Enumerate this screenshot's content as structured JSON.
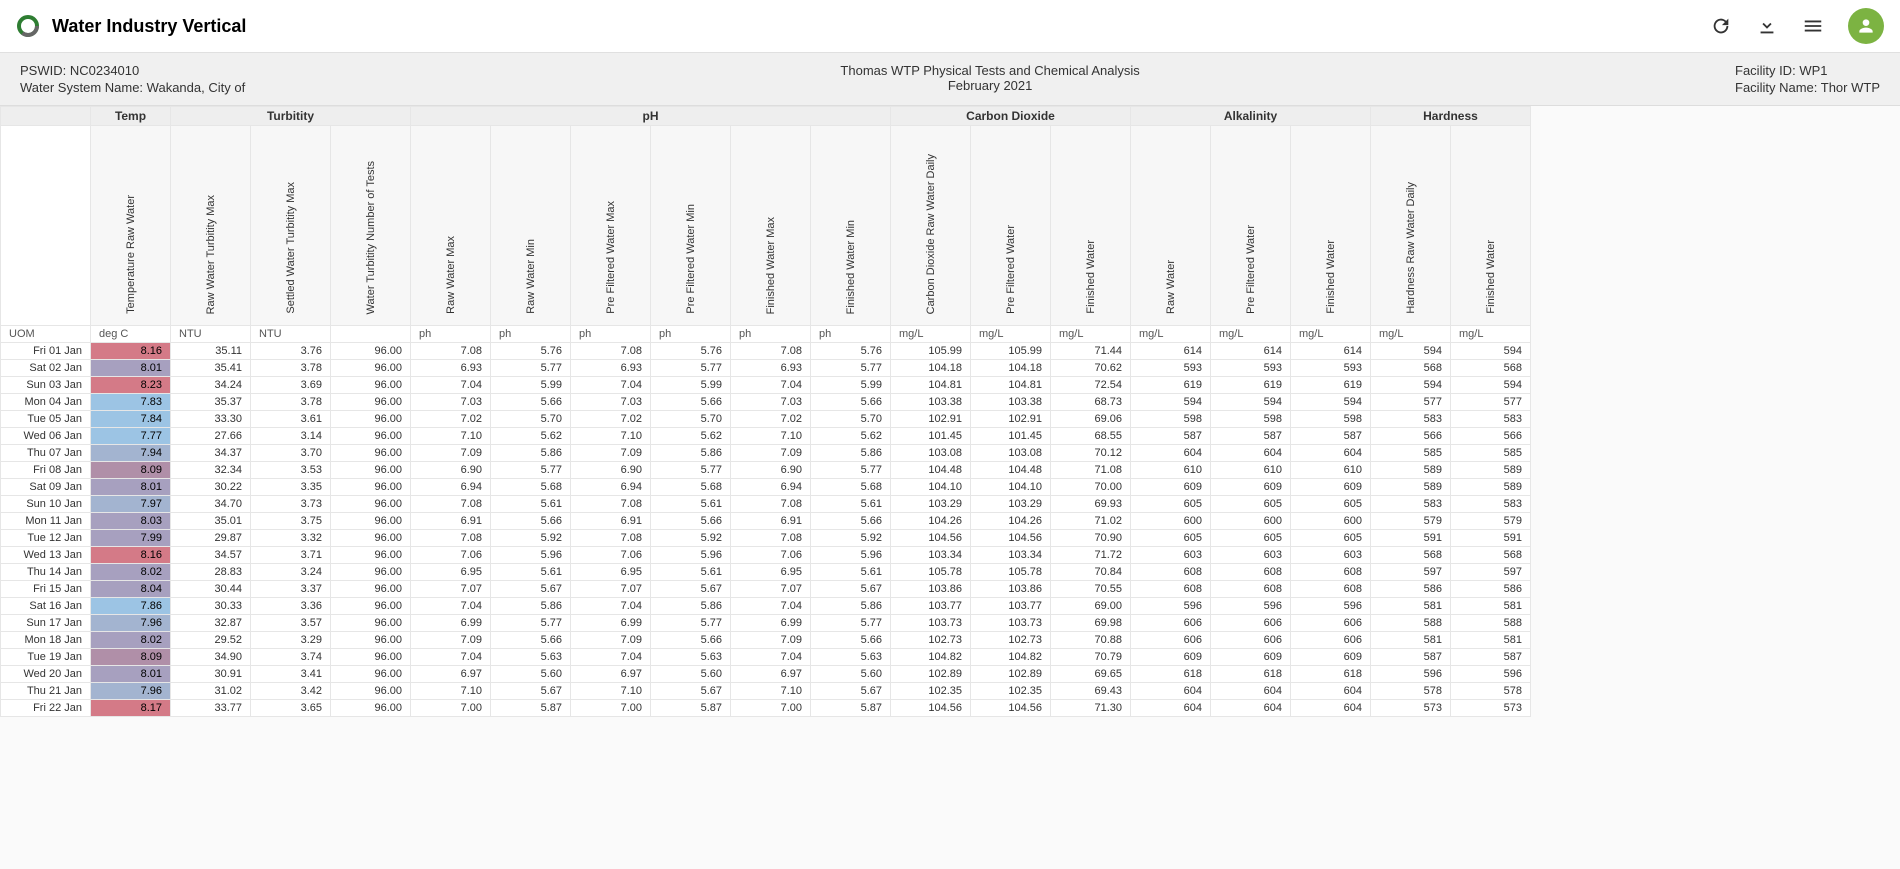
{
  "app": {
    "title": "Water Industry Vertical"
  },
  "info": {
    "left": {
      "pswid_label": "PSWID:",
      "pswid_value": "NC0234010",
      "wsn_label": "Water System Name:",
      "wsn_value": "Wakanda, City of"
    },
    "center": {
      "title": "Thomas WTP Physical Tests and Chemical Analysis",
      "subtitle": "February 2021"
    },
    "right": {
      "facid_label": "Facility ID:",
      "facid_value": "WP1",
      "facname_label": "Facility Name:",
      "facname_value": "Thor WTP"
    }
  },
  "groups": [
    {
      "label": "",
      "span": 1
    },
    {
      "label": "Temp",
      "span": 1
    },
    {
      "label": "Turbitity",
      "span": 3
    },
    {
      "label": "pH",
      "span": 6
    },
    {
      "label": "Carbon Dioxide",
      "span": 3
    },
    {
      "label": "Alkalinity",
      "span": 3
    },
    {
      "label": "Hardness",
      "span": 2
    }
  ],
  "subheaders": [
    "",
    "Temperature Raw Water",
    "Raw Water Turbitity Max",
    "Settled Water Turbitity Max",
    "Water Turbitity Number of Tests",
    "Raw Water Max",
    "Raw Water Min",
    "Pre Filtered Water Max",
    "Pre Filtered Water Min",
    "Finished Water Max",
    "Finished Water Min",
    "Carbon Dioxide Raw Water Daily",
    "Pre Filtered Water",
    "Finished Water",
    "Raw Water",
    "Pre Filtered Water",
    "Finished Water",
    "Hardness Raw Water Daily",
    "Finished Water"
  ],
  "uom_label": "UOM",
  "uom": [
    "deg C",
    "NTU",
    "NTU",
    "",
    "ph",
    "ph",
    "ph",
    "ph",
    "ph",
    "ph",
    "mg/L",
    "mg/L",
    "mg/L",
    "mg/L",
    "mg/L",
    "mg/L",
    "mg/L",
    "mg/L"
  ],
  "rows": [
    {
      "date": "Fri 01 Jan",
      "v": [
        8.16,
        35.11,
        3.76,
        96.0,
        7.08,
        5.76,
        7.08,
        5.76,
        7.08,
        5.76,
        105.99,
        105.99,
        71.44,
        614,
        614,
        614,
        594,
        594
      ]
    },
    {
      "date": "Sat 02 Jan",
      "v": [
        8.01,
        35.41,
        3.78,
        96.0,
        6.93,
        5.77,
        6.93,
        5.77,
        6.93,
        5.77,
        104.18,
        104.18,
        70.62,
        593,
        593,
        593,
        568,
        568
      ]
    },
    {
      "date": "Sun 03 Jan",
      "v": [
        8.23,
        34.24,
        3.69,
        96.0,
        7.04,
        5.99,
        7.04,
        5.99,
        7.04,
        5.99,
        104.81,
        104.81,
        72.54,
        619,
        619,
        619,
        594,
        594
      ]
    },
    {
      "date": "Mon 04 Jan",
      "v": [
        7.83,
        35.37,
        3.78,
        96.0,
        7.03,
        5.66,
        7.03,
        5.66,
        7.03,
        5.66,
        103.38,
        103.38,
        68.73,
        594,
        594,
        594,
        577,
        577
      ]
    },
    {
      "date": "Tue 05 Jan",
      "v": [
        7.84,
        33.3,
        3.61,
        96.0,
        7.02,
        5.7,
        7.02,
        5.7,
        7.02,
        5.7,
        102.91,
        102.91,
        69.06,
        598,
        598,
        598,
        583,
        583
      ]
    },
    {
      "date": "Wed 06 Jan",
      "v": [
        7.77,
        27.66,
        3.14,
        96.0,
        7.1,
        5.62,
        7.1,
        5.62,
        7.1,
        5.62,
        101.45,
        101.45,
        68.55,
        587,
        587,
        587,
        566,
        566
      ]
    },
    {
      "date": "Thu 07 Jan",
      "v": [
        7.94,
        34.37,
        3.7,
        96.0,
        7.09,
        5.86,
        7.09,
        5.86,
        7.09,
        5.86,
        103.08,
        103.08,
        70.12,
        604,
        604,
        604,
        585,
        585
      ]
    },
    {
      "date": "Fri 08 Jan",
      "v": [
        8.09,
        32.34,
        3.53,
        96.0,
        6.9,
        5.77,
        6.9,
        5.77,
        6.9,
        5.77,
        104.48,
        104.48,
        71.08,
        610,
        610,
        610,
        589,
        589
      ]
    },
    {
      "date": "Sat 09 Jan",
      "v": [
        8.01,
        30.22,
        3.35,
        96.0,
        6.94,
        5.68,
        6.94,
        5.68,
        6.94,
        5.68,
        104.1,
        104.1,
        70.0,
        609,
        609,
        609,
        589,
        589
      ]
    },
    {
      "date": "Sun 10 Jan",
      "v": [
        7.97,
        34.7,
        3.73,
        96.0,
        7.08,
        5.61,
        7.08,
        5.61,
        7.08,
        5.61,
        103.29,
        103.29,
        69.93,
        605,
        605,
        605,
        583,
        583
      ]
    },
    {
      "date": "Mon 11 Jan",
      "v": [
        8.03,
        35.01,
        3.75,
        96.0,
        6.91,
        5.66,
        6.91,
        5.66,
        6.91,
        5.66,
        104.26,
        104.26,
        71.02,
        600,
        600,
        600,
        579,
        579
      ]
    },
    {
      "date": "Tue 12 Jan",
      "v": [
        7.99,
        29.87,
        3.32,
        96.0,
        7.08,
        5.92,
        7.08,
        5.92,
        7.08,
        5.92,
        104.56,
        104.56,
        70.9,
        605,
        605,
        605,
        591,
        591
      ]
    },
    {
      "date": "Wed 13 Jan",
      "v": [
        8.16,
        34.57,
        3.71,
        96.0,
        7.06,
        5.96,
        7.06,
        5.96,
        7.06,
        5.96,
        103.34,
        103.34,
        71.72,
        603,
        603,
        603,
        568,
        568
      ]
    },
    {
      "date": "Thu 14 Jan",
      "v": [
        8.02,
        28.83,
        3.24,
        96.0,
        6.95,
        5.61,
        6.95,
        5.61,
        6.95,
        5.61,
        105.78,
        105.78,
        70.84,
        608,
        608,
        608,
        597,
        597
      ]
    },
    {
      "date": "Fri 15 Jan",
      "v": [
        8.04,
        30.44,
        3.37,
        96.0,
        7.07,
        5.67,
        7.07,
        5.67,
        7.07,
        5.67,
        103.86,
        103.86,
        70.55,
        608,
        608,
        608,
        586,
        586
      ]
    },
    {
      "date": "Sat 16 Jan",
      "v": [
        7.86,
        30.33,
        3.36,
        96.0,
        7.04,
        5.86,
        7.04,
        5.86,
        7.04,
        5.86,
        103.77,
        103.77,
        69.0,
        596,
        596,
        596,
        581,
        581
      ]
    },
    {
      "date": "Sun 17 Jan",
      "v": [
        7.96,
        32.87,
        3.57,
        96.0,
        6.99,
        5.77,
        6.99,
        5.77,
        6.99,
        5.77,
        103.73,
        103.73,
        69.98,
        606,
        606,
        606,
        588,
        588
      ]
    },
    {
      "date": "Mon 18 Jan",
      "v": [
        8.02,
        29.52,
        3.29,
        96.0,
        7.09,
        5.66,
        7.09,
        5.66,
        7.09,
        5.66,
        102.73,
        102.73,
        70.88,
        606,
        606,
        606,
        581,
        581
      ]
    },
    {
      "date": "Tue 19 Jan",
      "v": [
        8.09,
        34.9,
        3.74,
        96.0,
        7.04,
        5.63,
        7.04,
        5.63,
        7.04,
        5.63,
        104.82,
        104.82,
        70.79,
        609,
        609,
        609,
        587,
        587
      ]
    },
    {
      "date": "Wed 20 Jan",
      "v": [
        8.01,
        30.91,
        3.41,
        96.0,
        6.97,
        5.6,
        6.97,
        5.6,
        6.97,
        5.6,
        102.89,
        102.89,
        69.65,
        618,
        618,
        618,
        596,
        596
      ]
    },
    {
      "date": "Thu 21 Jan",
      "v": [
        7.96,
        31.02,
        3.42,
        96.0,
        7.1,
        5.67,
        7.1,
        5.67,
        7.1,
        5.67,
        102.35,
        102.35,
        69.43,
        604,
        604,
        604,
        578,
        578
      ]
    },
    {
      "date": "Fri 22 Jan",
      "v": [
        8.17,
        33.77,
        3.65,
        96.0,
        7.0,
        5.87,
        7.0,
        5.87,
        7.0,
        5.87,
        104.56,
        104.56,
        71.3,
        604,
        604,
        604,
        573,
        573
      ]
    }
  ]
}
